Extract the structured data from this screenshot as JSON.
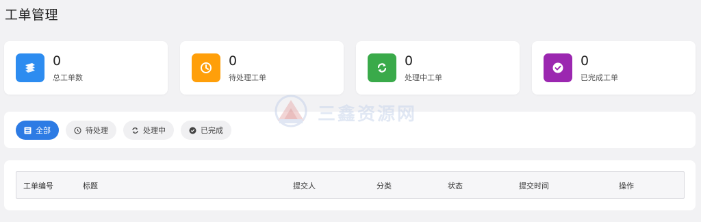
{
  "page": {
    "title": "工单管理"
  },
  "stats": [
    {
      "value": "0",
      "label": "总工单数",
      "icon": "layers-icon",
      "color": "#2d8cf0"
    },
    {
      "value": "0",
      "label": "待处理工单",
      "icon": "clock-icon",
      "color": "#ff9f0a"
    },
    {
      "value": "0",
      "label": "处理中工单",
      "icon": "refresh-icon",
      "color": "#3aaa4a"
    },
    {
      "value": "0",
      "label": "已完成工单",
      "icon": "check-circle-icon",
      "color": "#9b27b0"
    }
  ],
  "filters": [
    {
      "label": "全部",
      "icon": "list-icon",
      "active": true
    },
    {
      "label": "待处理",
      "icon": "clock-icon",
      "active": false
    },
    {
      "label": "处理中",
      "icon": "refresh-icon",
      "active": false
    },
    {
      "label": "已完成",
      "icon": "check-circle-icon",
      "active": false
    }
  ],
  "table": {
    "columns": [
      "工单编号",
      "标题",
      "提交人",
      "分类",
      "状态",
      "提交时间",
      "操作"
    ]
  },
  "watermark": {
    "text": "三鑫资源网"
  },
  "colors": {
    "accent": "#2d7be4",
    "background": "#f2f2f4"
  }
}
